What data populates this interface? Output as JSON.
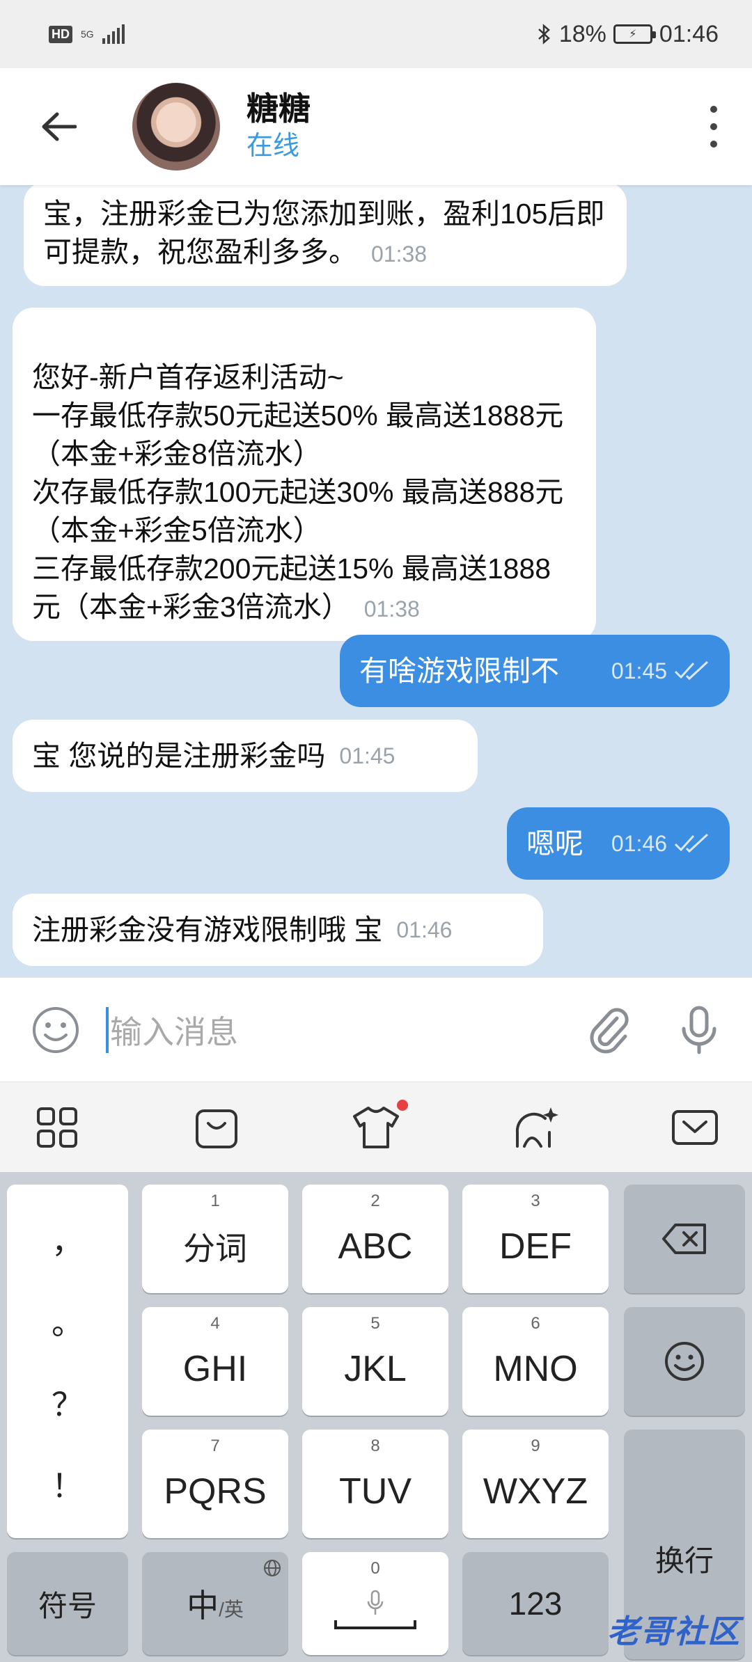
{
  "status_bar": {
    "hd": "HD",
    "network": "5G",
    "battery_percent": "18%",
    "time": "01:46"
  },
  "header": {
    "contact_name": "糖糖",
    "contact_status": "在线"
  },
  "messages": [
    {
      "direction": "incoming",
      "text": "宝，注册彩金已为您添加到账，盈利105后即可提款，祝您盈利多多。",
      "time": "01:38"
    },
    {
      "direction": "incoming",
      "text": "您好-新户首存返利活动~\n一存最低存款50元起送50%  最高送1888元（本金+彩金8倍流水）\n次存最低存款100元起送30%  最高送888元（本金+彩金5倍流水）\n三存最低存款200元起送15%  最高送1888元（本金+彩金3倍流水）",
      "time": "01:38"
    },
    {
      "direction": "outgoing",
      "text": "有啥游戏限制不",
      "time": "01:45"
    },
    {
      "direction": "incoming",
      "text": "宝 您说的是注册彩金吗",
      "time": "01:45"
    },
    {
      "direction": "outgoing",
      "text": "嗯呢",
      "time": "01:46"
    },
    {
      "direction": "incoming",
      "text": "注册彩金没有游戏限制哦 宝",
      "time": "01:46"
    }
  ],
  "input": {
    "placeholder": "输入消息"
  },
  "keyboard": {
    "punctuation": [
      "，",
      "。",
      "？",
      "！"
    ],
    "keys": [
      {
        "num": "1",
        "label": "分词"
      },
      {
        "num": "2",
        "label": "ABC"
      },
      {
        "num": "3",
        "label": "DEF"
      },
      {
        "num": "4",
        "label": "GHI"
      },
      {
        "num": "5",
        "label": "JKL"
      },
      {
        "num": "6",
        "label": "MNO"
      },
      {
        "num": "7",
        "label": "PQRS"
      },
      {
        "num": "8",
        "label": "TUV"
      },
      {
        "num": "9",
        "label": "WXYZ"
      }
    ],
    "symbols_key": "符号",
    "lang_key_main": "中",
    "lang_key_sub": "/英",
    "space_num": "0",
    "numbers_key": "123",
    "enter_key": "换行"
  },
  "watermark": "老哥社区",
  "colors": {
    "chat_background": "#d3e2f0",
    "outgoing_bubble": "#3c8ee3",
    "status_online": "#3a9ae0"
  }
}
